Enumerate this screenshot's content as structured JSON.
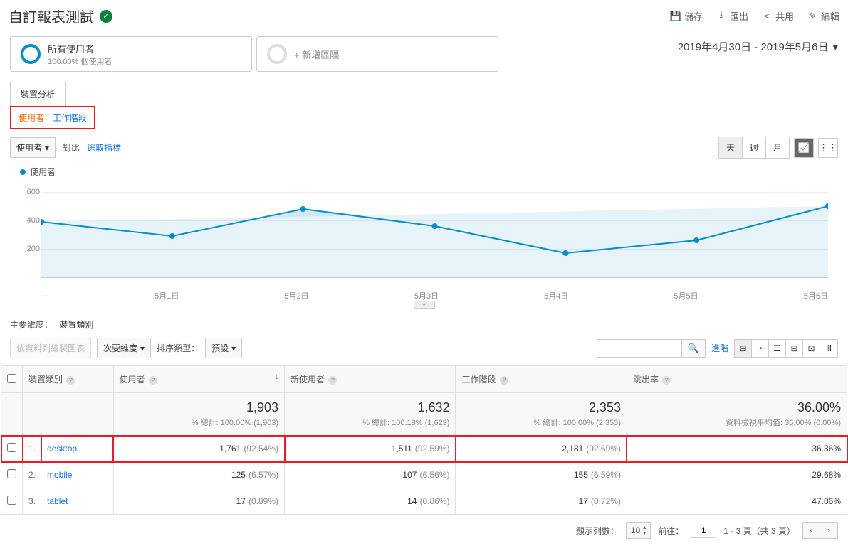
{
  "header": {
    "title": "自訂報表測試",
    "actions": {
      "save": "儲存",
      "export": "匯出",
      "share": "共用",
      "edit": "編輯"
    }
  },
  "segments": {
    "all_users_title": "所有使用者",
    "all_users_sub": "100.00% 個使用者",
    "add_segment": "+ 新增區隔"
  },
  "date_range": "2019年4月30日 - 2019年5月6日",
  "tab": "裝置分析",
  "highlight_tabs": {
    "users": "使用者",
    "sessions": "工作階段"
  },
  "controls": {
    "metric_dropdown": "使用者",
    "compare": "對比",
    "select_metric": "選取指標",
    "granularity": {
      "day": "天",
      "week": "週",
      "month": "月"
    }
  },
  "legend": "使用者",
  "chart_data": {
    "type": "line",
    "title": "使用者",
    "xlabel": "",
    "ylabel": "",
    "ylim": [
      0,
      700
    ],
    "y_ticks": [
      200,
      400,
      600
    ],
    "categories": [
      "…",
      "5月1日",
      "5月2日",
      "5月3日",
      "5月4日",
      "5月5日",
      "5月6日"
    ],
    "series": [
      {
        "name": "使用者",
        "values": [
          390,
          290,
          480,
          360,
          170,
          260,
          500
        ]
      }
    ]
  },
  "dimension": {
    "label": "主要維度：",
    "value": "裝置類別"
  },
  "table_controls": {
    "plot_rows": "依資料列繪製圖表",
    "secondary_dim": "次要維度",
    "sort_type_label": "排序類型：",
    "sort_type_value": "預設",
    "advanced": "進階"
  },
  "table": {
    "headers": {
      "device": "裝置類別",
      "users": "使用者",
      "new_users": "新使用者",
      "sessions": "工作階段",
      "bounce": "跳出率"
    },
    "summary": {
      "users": {
        "big": "1,903",
        "sub": "% 總計: 100.00% (1,903)"
      },
      "new_users": {
        "big": "1,632",
        "sub": "% 總計: 100.18% (1,629)"
      },
      "sessions": {
        "big": "2,353",
        "sub": "% 總計: 100.00% (2,353)"
      },
      "bounce": {
        "big": "36.00%",
        "sub": "資料檢視平均值: 36.00% (0.00%)"
      }
    },
    "rows": [
      {
        "idx": "1.",
        "device": "desktop",
        "users": "1,761",
        "users_pct": "(92.54%)",
        "new_users": "1,511",
        "new_users_pct": "(92.59%)",
        "sessions": "2,181",
        "sessions_pct": "(92.69%)",
        "bounce": "36.36%"
      },
      {
        "idx": "2.",
        "device": "mobile",
        "users": "125",
        "users_pct": "(6.57%)",
        "new_users": "107",
        "new_users_pct": "(6.56%)",
        "sessions": "155",
        "sessions_pct": "(6.59%)",
        "bounce": "29.68%"
      },
      {
        "idx": "3.",
        "device": "tablet",
        "users": "17",
        "users_pct": "(0.89%)",
        "new_users": "14",
        "new_users_pct": "(0.86%)",
        "sessions": "17",
        "sessions_pct": "(0.72%)",
        "bounce": "47.06%"
      }
    ]
  },
  "pagination": {
    "rows_label": "顯示列數：",
    "rows_value": "10",
    "goto_label": "前往：",
    "goto_value": "1",
    "range": "1 - 3 頁（共 3 頁）"
  }
}
